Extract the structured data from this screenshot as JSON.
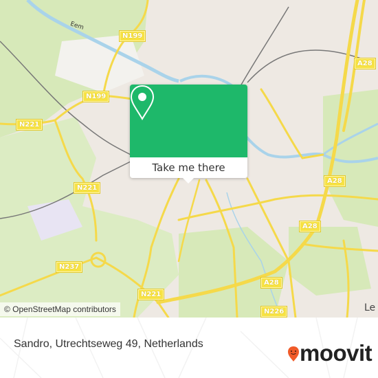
{
  "map": {
    "attribution": "© OpenStreetMap contributors",
    "road_labels": [
      {
        "id": "n199-top",
        "text": "N199"
      },
      {
        "id": "n199-mid",
        "text": "N199"
      },
      {
        "id": "n221-left",
        "text": "N221"
      },
      {
        "id": "n221-mid",
        "text": "N221"
      },
      {
        "id": "n237",
        "text": "N237"
      },
      {
        "id": "n221-bottom",
        "text": "N221"
      },
      {
        "id": "a28-top",
        "text": "A28"
      },
      {
        "id": "a28-right",
        "text": "A28"
      },
      {
        "id": "a28-mid",
        "text": "A28"
      },
      {
        "id": "a28-bottom",
        "text": "A28"
      },
      {
        "id": "n226",
        "text": "N226"
      }
    ],
    "place_labels": {
      "river": "Eem",
      "city_partial": "Le"
    },
    "colors": {
      "highway": "#f7e244",
      "water": "#a9d3ea",
      "green": "#d7e9b9",
      "urban": "#eee9e3"
    }
  },
  "popup": {
    "button_label": "Take me there",
    "pin_icon": "map-pin-icon",
    "color": "#1eb86a"
  },
  "footer": {
    "address": "Sandro, Utrechtseweg 49, Netherlands",
    "brand": "moovit",
    "brand_color": "#f05a28"
  }
}
